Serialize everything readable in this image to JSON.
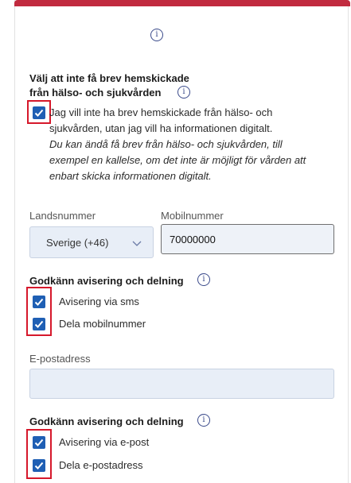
{
  "header": {
    "info_icon": "info-icon"
  },
  "letters": {
    "title": "Välj att inte få brev hemskickade",
    "title_line2": "från hälso- och sjukvården",
    "checkbox_checked": true,
    "text_line1": "Jag vill inte ha brev hemskickade från hälso- och",
    "text_line2": "sjukvården, utan jag vill ha informationen digitalt.",
    "note_line1": "Du kan ändå få brev från hälso- och sjukvården, till",
    "note_line2": "exempel en kallelse, om det inte är möjligt för vården att",
    "note_line3": "enbart skicka informationen digitalt."
  },
  "phone": {
    "country_label": "Landsnummer",
    "country_value": "Sverige (+46)",
    "mobile_label": "Mobilnummer",
    "mobile_value": "70000000"
  },
  "sms_consent": {
    "title": "Godkänn avisering och delning",
    "option1": "Avisering via sms",
    "option1_checked": true,
    "option2": "Dela mobilnummer",
    "option2_checked": true
  },
  "email": {
    "label": "E-postadress",
    "value": ""
  },
  "email_consent": {
    "title": "Godkänn avisering och delning",
    "option1": "Avisering via e-post",
    "option1_checked": true,
    "option2": "Dela e-postadress",
    "option2_checked": true
  },
  "colors": {
    "accent_red": "#c12b3f",
    "checkbox_blue": "#1f5fb4",
    "highlight_red": "#d6182b"
  }
}
